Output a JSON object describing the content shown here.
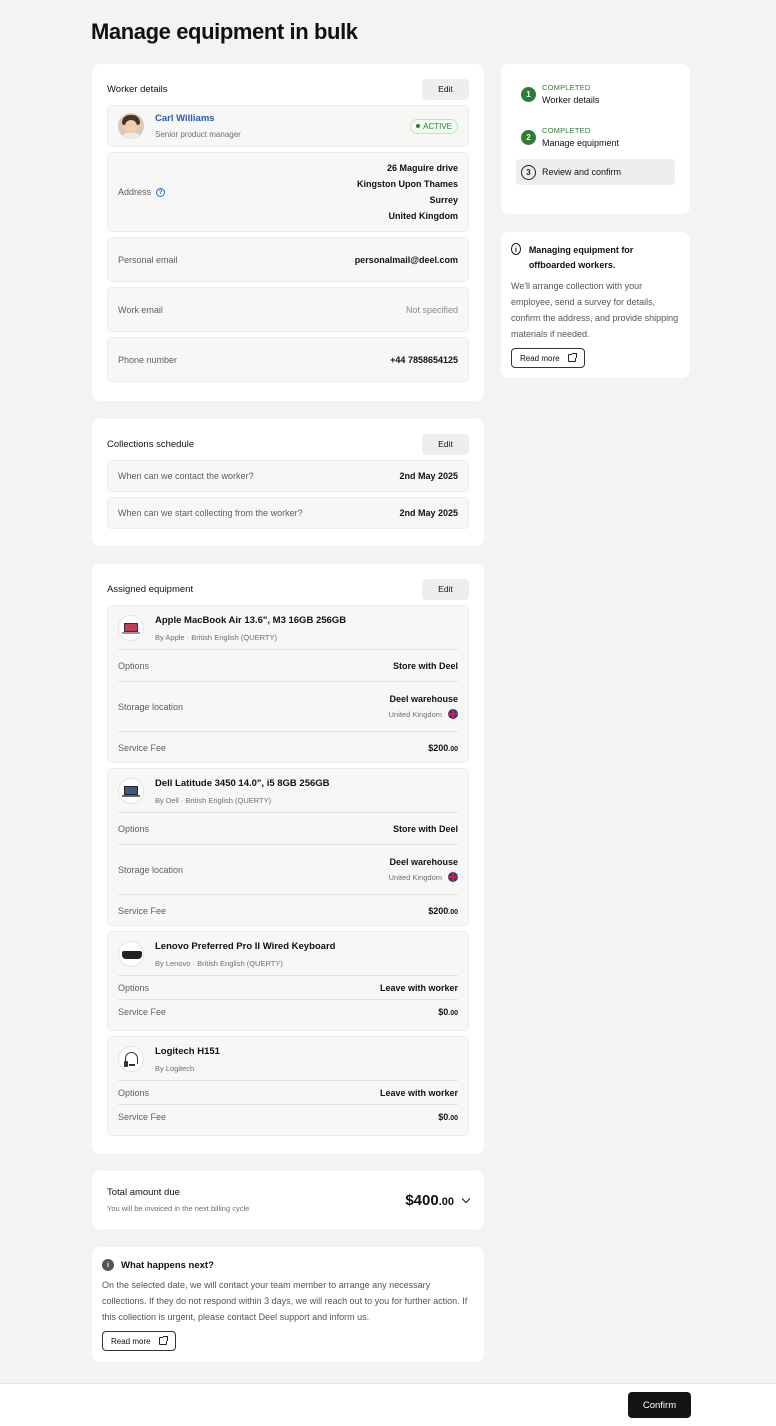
{
  "page": {
    "title": "Manage equipment in bulk"
  },
  "worker": {
    "title": "Worker details",
    "edit": "Edit",
    "name": "Carl Williams",
    "role": "Senior product manager",
    "status": "ACTIVE",
    "address_label": "Address",
    "address": [
      "26 Maguire drive",
      "Kingston Upon Thames",
      "Surrey",
      "United Kingdom"
    ],
    "personal_email_label": "Personal email",
    "personal_email": "personalmail@deel.com",
    "work_email_label": "Work email",
    "work_email": "Not specified",
    "phone_label": "Phone number",
    "phone": "+44 7858654125"
  },
  "schedule": {
    "title": "Collections schedule",
    "edit": "Edit",
    "contact_label": "When can we contact the worker?",
    "contact_date": "2nd May 2025",
    "collect_label": "When can we start collecting from the worker?",
    "collect_date": "2nd May 2025"
  },
  "equipment": {
    "title": "Assigned equipment",
    "edit": "Edit",
    "options_label": "Options",
    "storage_label": "Storage location",
    "fee_label": "Service Fee",
    "items": [
      {
        "name": "Apple MacBook Air 13.6\", M3 16GB 256GB",
        "sub": "By Apple · British English (QUERTY)",
        "option": "Store with Deel",
        "storage": "Deel warehouse",
        "country": "United Kingdom",
        "fee_main": "$200",
        "fee_cents": ".00"
      },
      {
        "name": "Dell Latitude 3450 14.0\", i5 8GB 256GB",
        "sub": "By Dell · British English (QUERTY)",
        "option": "Store with Deel",
        "storage": "Deel warehouse",
        "country": "United Kingdom",
        "fee_main": "$200",
        "fee_cents": ".00"
      },
      {
        "name": "Lenovo Preferred Pro II Wired Keyboard",
        "sub": "By Lenovo · British English (QUERTY)",
        "option": "Leave with worker",
        "fee_main": "$0",
        "fee_cents": ".00"
      },
      {
        "name": "Logitech H151",
        "sub": "By Logitech",
        "option": "Leave with worker",
        "fee_main": "$0",
        "fee_cents": ".00"
      }
    ]
  },
  "total": {
    "label": "Total amount due",
    "note": "You will be invoiced in the next billing cycle",
    "main": "$400",
    "cents": ".00"
  },
  "next": {
    "title": "What happens next?",
    "text": "On the selected date, we will contact your team member to arrange any necessary collections. If they do not respond within 3 days, we will reach out to you for further action. If this collection is urgent, please contact Deel support and inform us.",
    "read_more": "Read more"
  },
  "steps": [
    {
      "num": "1",
      "status": "COMPLETED",
      "label": "Worker details"
    },
    {
      "num": "2",
      "status": "COMPLETED",
      "label": "Manage equipment"
    },
    {
      "num": "3",
      "label": "Review and confirm"
    }
  ],
  "info": {
    "title": "Managing equipment for offboarded workers.",
    "text": "We'll arrange collection with your employee, send a survey for details, confirm the address, and provide shipping materials if needed.",
    "read_more": "Read more"
  },
  "footer": {
    "confirm": "Confirm"
  },
  "colors": {
    "accent_green": "#2e7d32",
    "link_blue": "#2a5aa8",
    "primary_button": "#141414"
  }
}
